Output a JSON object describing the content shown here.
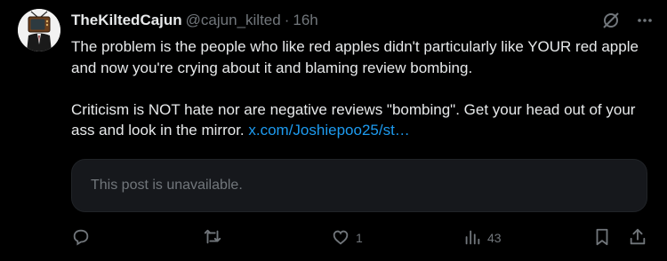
{
  "author": {
    "display_name": "TheKiltedCajun",
    "handle": "@cajun_kilted",
    "separator": "·",
    "timestamp": "16h"
  },
  "post": {
    "paragraph1": "The problem is the people who like red apples didn't particularly like YOUR red apple and now you're crying about it and blaming review bombing.",
    "paragraph2_text": "Criticism is NOT hate nor are negative reviews \"bombing\". Get your head out of your ass and look in the mirror. ",
    "paragraph2_link": "x.com/Joshiepoo25/st…"
  },
  "quote": {
    "unavailable_text": "This post is unavailable."
  },
  "actions": {
    "reply_count": "",
    "repost_count": "",
    "like_count": "1",
    "views_count": "43"
  },
  "icons": {
    "grok": "grok-slash-circle-icon",
    "more": "more-dots-icon",
    "reply": "reply-bubble-icon",
    "repost": "repost-arrows-icon",
    "like": "heart-icon",
    "views": "bar-chart-icon",
    "bookmark": "bookmark-icon",
    "share": "share-upload-icon"
  },
  "colors": {
    "background": "#000000",
    "text_primary": "#e7e9ea",
    "text_secondary": "#71767b",
    "link": "#1d9bf0",
    "quote_background": "#16181c"
  }
}
